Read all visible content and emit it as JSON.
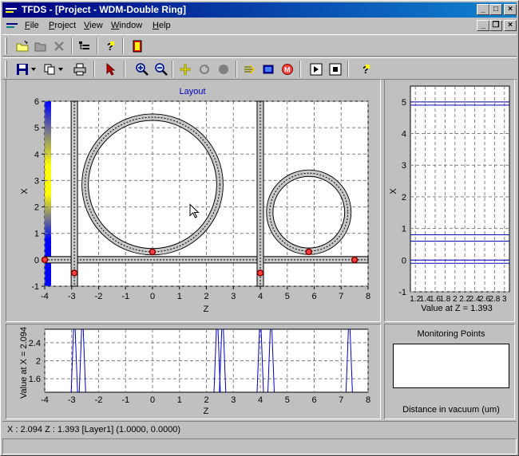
{
  "window": {
    "title": "TFDS - [Project - WDM-Double Ring]"
  },
  "menu": {
    "items": [
      {
        "label": "File",
        "underline": "F",
        "rest": "ile"
      },
      {
        "label": "Project",
        "underline": "P",
        "rest": "roject"
      },
      {
        "label": "View",
        "underline": "V",
        "rest": "iew"
      },
      {
        "label": "Window",
        "underline": "W",
        "rest": "indow"
      },
      {
        "label": "Help",
        "underline": "H",
        "rest": "elp"
      }
    ]
  },
  "layout_plot": {
    "title": "Layout",
    "xlabel": "Z",
    "ylabel": "X",
    "x_ticks": [
      "-4",
      "-3",
      "-2",
      "-1",
      "0",
      "1",
      "2",
      "3",
      "4",
      "5",
      "6",
      "7",
      "8"
    ],
    "y_ticks": [
      "-1",
      "0",
      "1",
      "2",
      "3",
      "4",
      "5",
      "6"
    ]
  },
  "right_plot": {
    "xlabel": "Value at Z = 1.393",
    "ylabel": "X",
    "x_ticks": [
      "1.2",
      "1.4",
      "1.6",
      "1.8",
      "2",
      "2.2",
      "2.4",
      "2.6",
      "2.8",
      "3"
    ],
    "y_ticks": [
      "-1",
      "0",
      "1",
      "2",
      "3",
      "4",
      "5"
    ]
  },
  "bottom_plot": {
    "xlabel": "Z",
    "ylabel": "Value at X = 2.094",
    "x_ticks": [
      "-4",
      "-3",
      "-2",
      "-1",
      "0",
      "1",
      "2",
      "3",
      "4",
      "5",
      "6",
      "7",
      "8"
    ],
    "y_ticks": [
      "1.6",
      "2",
      "2.4"
    ]
  },
  "monitoring": {
    "title": "Monitoring Points",
    "footer": "Distance in vacuum (um)"
  },
  "status": {
    "text": "X : 2.094  Z : 1.393 [Layer1] (1.0000, 0.0000)"
  },
  "chart_data": [
    {
      "type": "scatter",
      "title": "Layout",
      "xlabel": "Z",
      "ylabel": "X",
      "xlim": [
        -4,
        8
      ],
      "ylim": [
        -1,
        6
      ],
      "grid": true,
      "waveguides": [
        {
          "kind": "straight",
          "z": [
            -4,
            8
          ],
          "x": 0
        },
        {
          "kind": "vertical",
          "z": -2.9,
          "x": [
            -1,
            6
          ]
        },
        {
          "kind": "vertical",
          "z": 4.0,
          "x": [
            -1,
            6
          ]
        },
        {
          "kind": "ring",
          "center_z": 0,
          "center_x": 2.85,
          "radius": 2.5
        },
        {
          "kind": "ring",
          "center_z": 5.8,
          "center_x": 1.8,
          "radius": 1.45
        }
      ],
      "ports": [
        {
          "z": -4,
          "x": 0
        },
        {
          "z": -2.9,
          "x": -0.5
        },
        {
          "z": 0,
          "x": 0.3
        },
        {
          "z": 4.0,
          "x": -0.5
        },
        {
          "z": 5.8,
          "x": 0.3
        },
        {
          "z": 7.5,
          "x": 0
        }
      ]
    },
    {
      "type": "line",
      "xlabel": "Value at Z = 1.393",
      "ylabel": "X",
      "xlim": [
        1.1,
        3.1
      ],
      "ylim": [
        -1,
        5.5
      ],
      "grid": true,
      "series": [
        {
          "points": [
            [
              1.1,
              5
            ],
            [
              3.1,
              5
            ]
          ]
        },
        {
          "points": [
            [
              1.1,
              4.9
            ],
            [
              3.1,
              4.9
            ]
          ]
        },
        {
          "points": [
            [
              1.1,
              0.8
            ],
            [
              3.1,
              0.8
            ]
          ]
        },
        {
          "points": [
            [
              1.1,
              0.6
            ],
            [
              3.1,
              0.6
            ]
          ]
        },
        {
          "points": [
            [
              1.1,
              0
            ],
            [
              3.1,
              0
            ]
          ]
        },
        {
          "points": [
            [
              1.1,
              -0.1
            ],
            [
              3.1,
              -0.1
            ]
          ]
        }
      ]
    },
    {
      "type": "line",
      "xlabel": "Z",
      "ylabel": "Value at X = 2.094",
      "xlim": [
        -4,
        8
      ],
      "ylim": [
        1.3,
        2.7
      ],
      "grid": true,
      "peaks_z": [
        -2.9,
        -2.6,
        2.4,
        2.6,
        4.0,
        4.4,
        7.3
      ]
    }
  ]
}
